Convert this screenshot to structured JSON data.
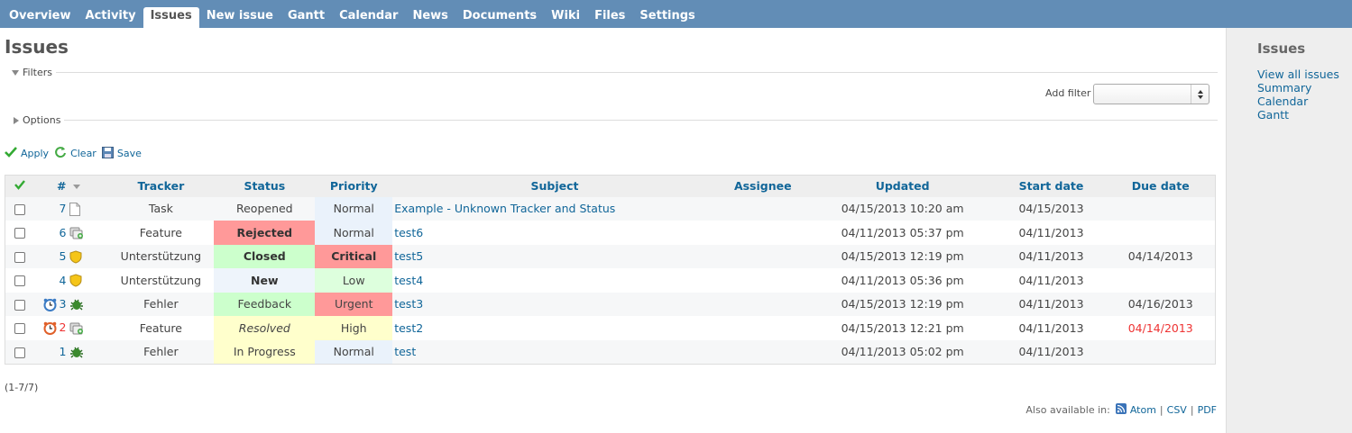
{
  "tabs": [
    {
      "label": "Overview",
      "selected": false
    },
    {
      "label": "Activity",
      "selected": false
    },
    {
      "label": "Issues",
      "selected": true
    },
    {
      "label": "New issue",
      "selected": false
    },
    {
      "label": "Gantt",
      "selected": false
    },
    {
      "label": "Calendar",
      "selected": false
    },
    {
      "label": "News",
      "selected": false
    },
    {
      "label": "Documents",
      "selected": false
    },
    {
      "label": "Wiki",
      "selected": false
    },
    {
      "label": "Files",
      "selected": false
    },
    {
      "label": "Settings",
      "selected": false
    }
  ],
  "page": {
    "title": "Issues"
  },
  "filters": {
    "legend": "Filters",
    "add_filter_label": "Add filter",
    "add_filter_value": ""
  },
  "options": {
    "legend": "Options"
  },
  "buttons": {
    "apply": "Apply",
    "clear": "Clear",
    "save": "Save"
  },
  "table": {
    "headers": {
      "id": "#",
      "tracker": "Tracker",
      "status": "Status",
      "priority": "Priority",
      "subject": "Subject",
      "assignee": "Assignee",
      "updated": "Updated",
      "start_date": "Start date",
      "due_date": "Due date"
    },
    "rows": [
      {
        "id": "7",
        "tracker_icon": "document-icon",
        "tracker": "Task",
        "status": "Reopened",
        "priority": "Normal",
        "subject": "Example - Unknown Tracker and Status",
        "assignee": "",
        "updated": "04/15/2013 10:20 am",
        "start_date": "04/15/2013",
        "due_date": ""
      },
      {
        "id": "6",
        "tracker_icon": "feature-icon",
        "tracker": "Feature",
        "status": "Rejected",
        "priority": "Normal",
        "subject": "test6",
        "assignee": "",
        "updated": "04/11/2013 05:37 pm",
        "start_date": "04/11/2013",
        "due_date": ""
      },
      {
        "id": "5",
        "tracker_icon": "support-shield-icon",
        "tracker": "Unterstützung",
        "status": "Closed",
        "priority": "Critical",
        "subject": "test5",
        "assignee": "",
        "updated": "04/15/2013 12:19 pm",
        "start_date": "04/11/2013",
        "due_date": "04/14/2013"
      },
      {
        "id": "4",
        "tracker_icon": "support-shield-icon",
        "tracker": "Unterstützung",
        "status": "New",
        "priority": "Low",
        "subject": "test4",
        "assignee": "",
        "updated": "04/11/2013 05:36 pm",
        "start_date": "04/11/2013",
        "due_date": ""
      },
      {
        "id": "3",
        "tracker_icon": "bug-icon",
        "status_icon": "clock-blue-icon",
        "tracker": "Fehler",
        "status": "Feedback",
        "priority": "Urgent",
        "subject": "test3",
        "assignee": "",
        "updated": "04/15/2013 12:19 pm",
        "start_date": "04/11/2013",
        "due_date": "04/16/2013"
      },
      {
        "id": "2",
        "tracker_icon": "feature-icon",
        "status_icon": "clock-red-icon",
        "tracker": "Feature",
        "status": "Resolved",
        "priority": "High",
        "subject": "test2",
        "assignee": "",
        "updated": "04/15/2013 12:21 pm",
        "start_date": "04/11/2013",
        "due_date": "04/14/2013"
      },
      {
        "id": "1",
        "tracker_icon": "bug-icon",
        "tracker": "Fehler",
        "status": "In Progress",
        "priority": "Normal",
        "subject": "test",
        "assignee": "",
        "updated": "04/11/2013 05:02 pm",
        "start_date": "04/11/2013",
        "due_date": ""
      }
    ]
  },
  "pagination": {
    "text": "(1-7/7)"
  },
  "export": {
    "label": "Also available in:",
    "atom": "Atom",
    "csv": "CSV",
    "pdf": "PDF",
    "sep": "|"
  },
  "sidebar": {
    "title": "Issues",
    "links": [
      {
        "label": "View all issues"
      },
      {
        "label": "Summary"
      },
      {
        "label": "Calendar"
      },
      {
        "label": "Gantt"
      }
    ]
  },
  "colors": {
    "header_bg": "#628db6",
    "link": "#116699",
    "overdue": "#ee3333"
  }
}
